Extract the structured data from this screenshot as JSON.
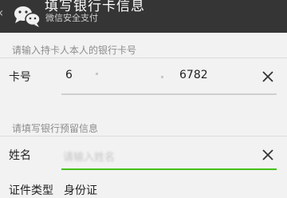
{
  "header": {
    "title": "填写银行卡信息",
    "subtitle": "微信安全支付"
  },
  "card_section": {
    "label": "请输入持卡人本人的银行卡号",
    "field_label": "卡号",
    "value_start": "6",
    "value_end": "6782"
  },
  "reserved_section": {
    "label": "请填写银行预留信息",
    "name_label": "姓名",
    "name_placeholder": "请输入姓名",
    "id_type_label": "证件类型",
    "id_type_value": "身份证"
  },
  "colors": {
    "titlebar": "#353535",
    "focus_underline": "#45c01a",
    "underline": "#cfcfcf"
  },
  "icons": [
    "back-arrow-icon",
    "wechat-logo-icon",
    "clear-icon"
  ]
}
